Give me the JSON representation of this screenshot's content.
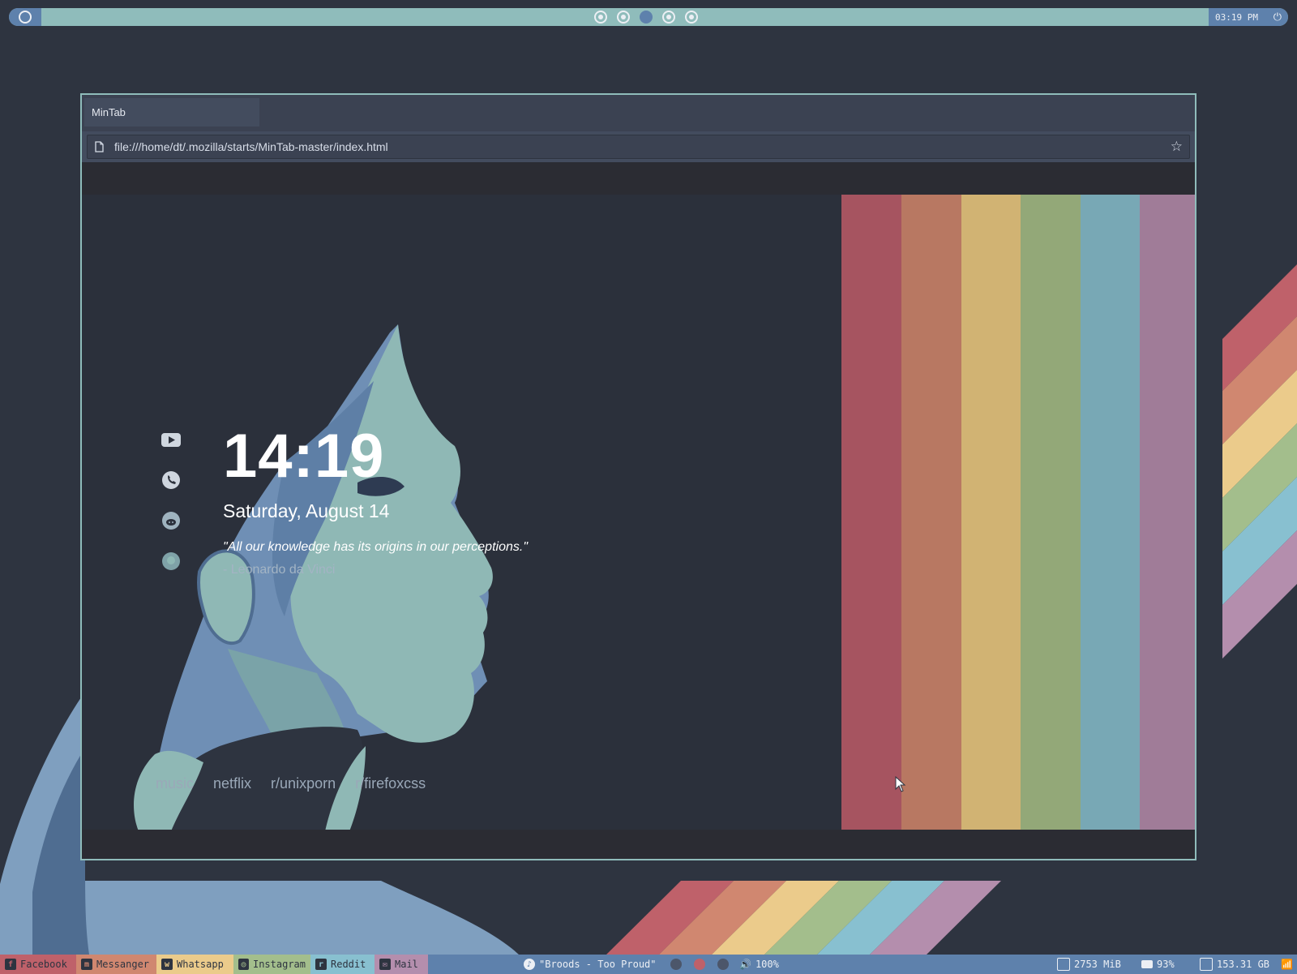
{
  "topbar": {
    "workspaces": [
      {
        "state": "inactive"
      },
      {
        "state": "inactive"
      },
      {
        "state": "active"
      },
      {
        "state": "inactive"
      },
      {
        "state": "inactive"
      }
    ],
    "clock": "03:19 PM",
    "power_icon": "power-icon"
  },
  "browser": {
    "tab_title": "MinTab",
    "url": "file:///home/dt/.mozilla/starts/MinTab-master/index.html"
  },
  "startpage": {
    "time": "14:19",
    "date": "Saturday, August 14",
    "quote": "\"All our knowledge has its origins in our perceptions.\"",
    "author": "- Leonardo da Vinci",
    "side_icons": [
      "youtube-icon",
      "whatsapp-icon",
      "reddit-icon",
      "github-icon"
    ],
    "links": [
      "music",
      "netflix",
      "r/unixporn",
      "r/firefoxcss"
    ],
    "stripe_colors": [
      "#a65460",
      "#b87862",
      "#d1b373",
      "#93a878",
      "#78a8b5",
      "#a07c98"
    ]
  },
  "taskbar": {
    "apps": [
      {
        "label": "Facebook",
        "icon": "facebook-icon",
        "color": "#bf616a"
      },
      {
        "label": "Messanger",
        "icon": "messenger-icon",
        "color": "#d08770"
      },
      {
        "label": "Whatsapp",
        "icon": "whatsapp-icon",
        "color": "#ebcb8b"
      },
      {
        "label": "Instagram",
        "icon": "instagram-icon",
        "color": "#a3be8c"
      },
      {
        "label": "Reddit",
        "icon": "reddit-icon",
        "color": "#88c0d0"
      },
      {
        "label": "Mail",
        "icon": "mail-icon",
        "color": "#b48ead"
      }
    ],
    "now_playing": "\"Broods - Too Proud\"",
    "volume": "100%",
    "memory": "2753 MiB",
    "battery": "93%",
    "disk": "153.31 GB"
  }
}
